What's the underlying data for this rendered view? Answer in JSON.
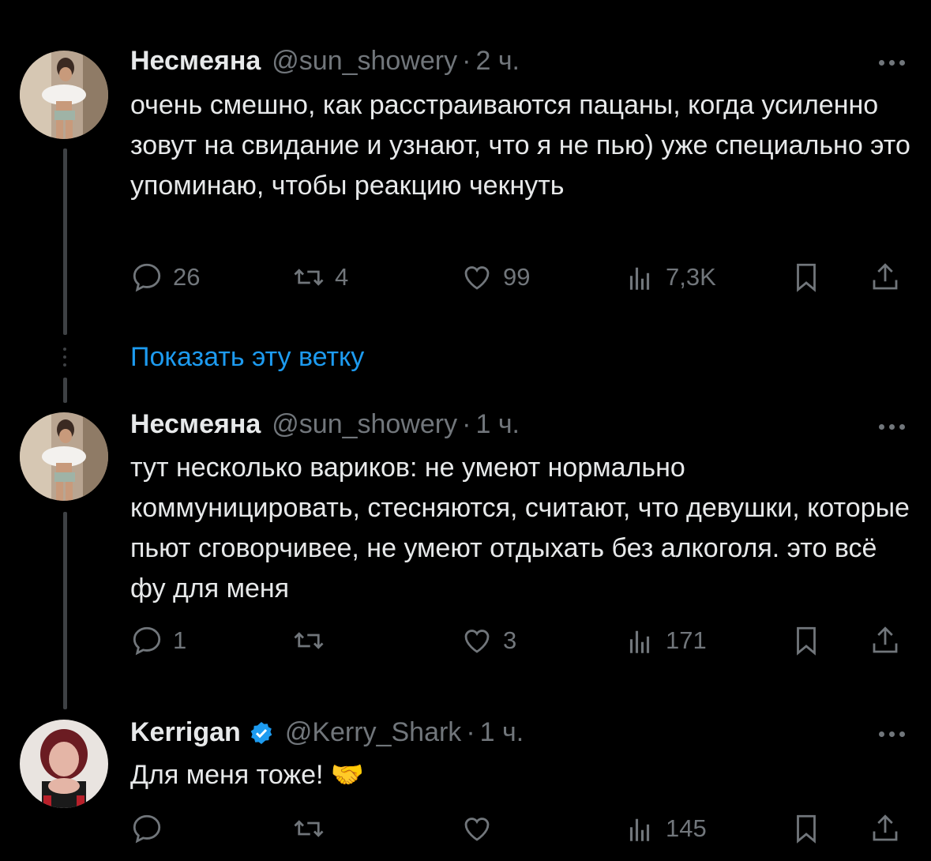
{
  "tweets": [
    {
      "name": "Несмеяна",
      "handle": "@sun_showery",
      "dot": "·",
      "time": "2 ч.",
      "text": "очень смешно, как расстраиваются пацаны, когда усиленно зовут на свидание и узнают, что я не пью) уже специально это упоминаю, чтобы реакцию чекнуть",
      "replies": "26",
      "retweets": "4",
      "likes": "99",
      "views": "7,3K"
    },
    {
      "name": "Несмеяна",
      "handle": "@sun_showery",
      "dot": "·",
      "time": "1 ч.",
      "text": "тут несколько вариков: не умеют нормально коммуницировать, стесняются, считают, что девушки, которые пьют сговорчивее, не умеют отдыхать без алкоголя. это всё фу для меня",
      "replies": "1",
      "retweets": "",
      "likes": "3",
      "views": "171"
    },
    {
      "name": "Kerrigan",
      "handle": "@Kerry_Shark",
      "dot": "·",
      "time": "1 ч.",
      "text": "Для меня тоже! 🤝",
      "replies": "",
      "retweets": "",
      "likes": "",
      "views": "145",
      "verified": true
    }
  ],
  "show_thread": "Показать эту ветку",
  "colors": {
    "background": "#000000",
    "text": "#e7e9ea",
    "muted": "#71767b",
    "link": "#1d9bf0",
    "verified": "#1d9bf0"
  },
  "icons": [
    "reply-icon",
    "retweet-icon",
    "like-icon",
    "views-icon",
    "bookmark-icon",
    "share-icon",
    "more-icon",
    "verified-icon"
  ]
}
